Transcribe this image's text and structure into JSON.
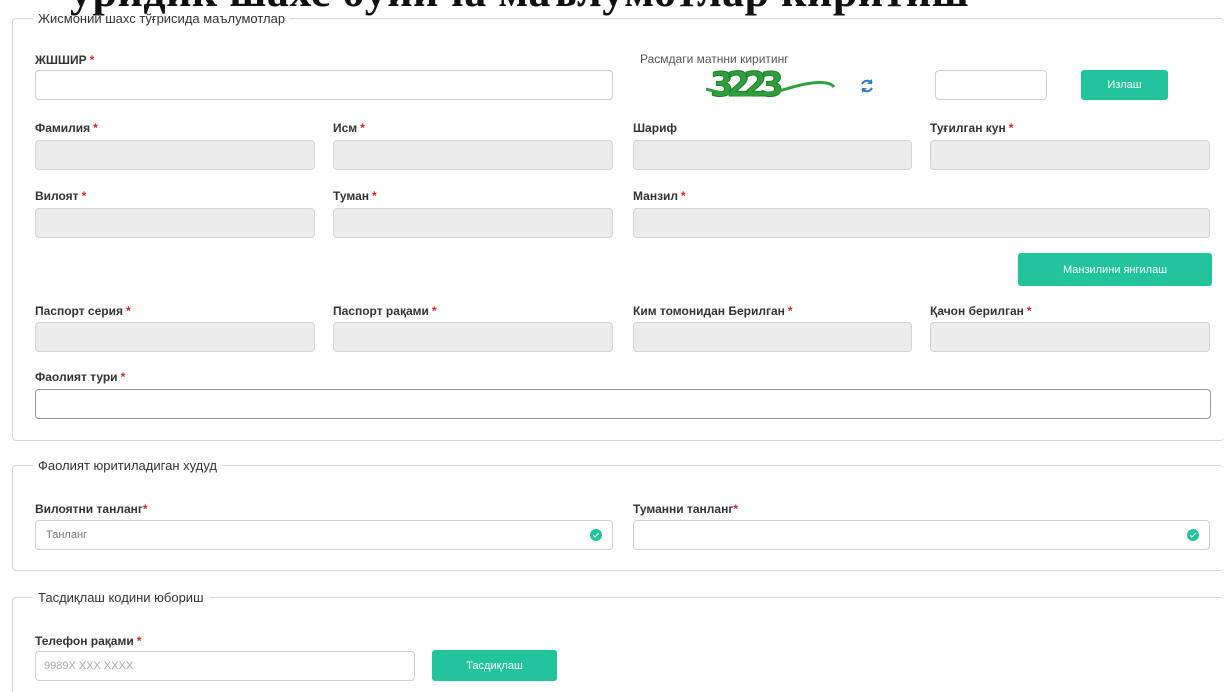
{
  "heading_fragment": "уридик шахс бўйича маълумотлар киритиш",
  "personal": {
    "legend": "Жисмоний шахс тўғрисида маълумотлар",
    "jshshir_label": "ЖШШИР",
    "captcha_label": "Расмдаги матнни киритинг",
    "captcha_text": "3223",
    "search_button": "Излаш",
    "last_name_label": "Фамилия",
    "first_name_label": "Исм",
    "patronymic_label": "Шариф",
    "birth_date_label": "Туғилган кун",
    "region_label": "Вилоят",
    "district_label": "Туман",
    "address_label": "Манзил",
    "update_address_button": "Манзилини янгилаш",
    "passport_series_label": "Паспорт серия",
    "passport_number_label": "Паспорт рақами",
    "issued_by_label": "Ким томонидан Берилган",
    "issued_date_label": "Қачон берилган",
    "activity_type_label": "Фаолият тури"
  },
  "territory": {
    "legend": "Фаолият юритиладиган худуд",
    "region_select_label": "Вилоятни танланг",
    "region_select_value": "Танланг",
    "district_select_label": "Туманни танланг",
    "district_select_value": ""
  },
  "verify": {
    "legend": "Тасдиқлаш кодини юбориш",
    "phone_label": "Телефон рақами",
    "phone_placeholder": "9989X XXX XXXX",
    "confirm_button": "Тасдиқлаш"
  },
  "required_mark": "*",
  "colors": {
    "accent": "#22c49c",
    "required": "#e02020",
    "readonly_bg": "#ececec"
  }
}
